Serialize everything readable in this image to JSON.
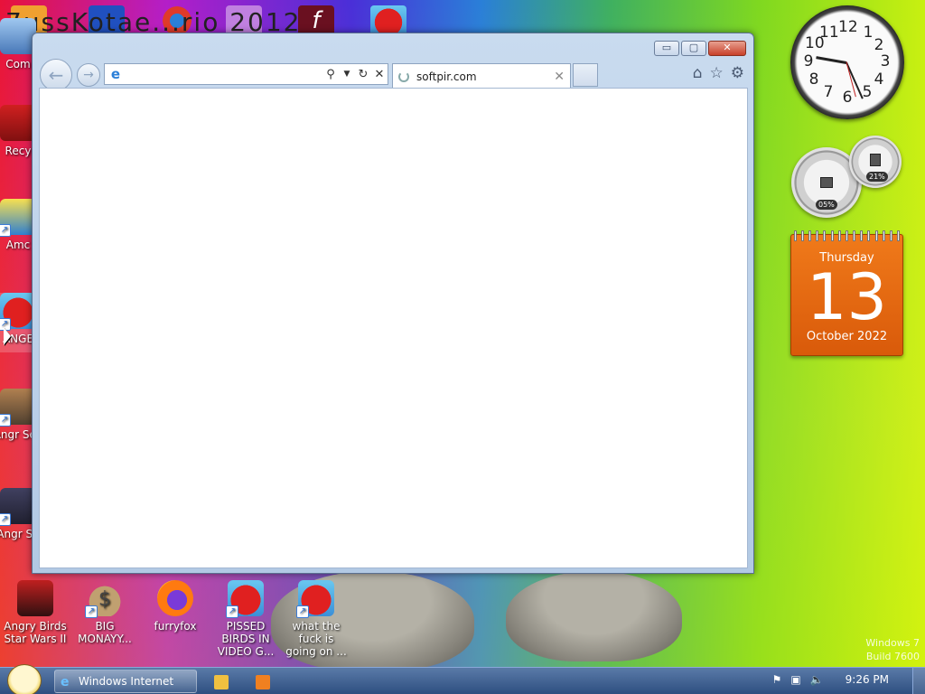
{
  "colors": {
    "taskbar": "#2e4f80",
    "calendar": "#e8680f",
    "window_frame": "#b2c9e4"
  },
  "desktop": {
    "top_text": "7ussKotae...rio 2012",
    "left_icons": [
      {
        "label": "Com",
        "icon": "computer-icon"
      },
      {
        "label": "Recy",
        "icon": "recycle-bin-icon"
      },
      {
        "label": "Amc",
        "icon": "amc-icon"
      },
      {
        "label": "ANGE",
        "icon": "angry-birds-icon"
      },
      {
        "label": "Angr Sea",
        "icon": "angry-birds-seasons-icon"
      },
      {
        "label": "Angr Sp",
        "icon": "angry-birds-space-icon"
      }
    ],
    "bottom_icons": [
      {
        "label": "Angry Birds Star Wars II",
        "icon": "angry-birds-star-wars-icon"
      },
      {
        "label": "BIG MONAYY...",
        "icon": "money-bag-icon"
      },
      {
        "label": "furryfox",
        "icon": "firefox-icon"
      },
      {
        "label": "PISSED BIRDS IN VIDEO G...",
        "icon": "angry-bird-icon"
      },
      {
        "label": "what the fuck is going on ...",
        "icon": "angry-bird-icon"
      }
    ],
    "watermark_line1": "Windows 7",
    "watermark_line2": "Build 7600"
  },
  "browser": {
    "address_value": "",
    "tab_title": "softpir.com",
    "min_label": "▭",
    "max_label": "▢",
    "close_label": "✕"
  },
  "gadgets": {
    "clock": {
      "numbers": [
        "12",
        "1",
        "2",
        "3",
        "4",
        "5",
        "6",
        "7",
        "8",
        "9",
        "10",
        "11"
      ],
      "time": "9:26"
    },
    "meter": {
      "cpu": "05%",
      "mem": "21%"
    },
    "calendar": {
      "day_name": "Thursday",
      "day": "13",
      "month_year": "October 2022"
    }
  },
  "taskbar": {
    "task_ie": "Windows Internet Ex...",
    "time": "9:26 PM"
  }
}
